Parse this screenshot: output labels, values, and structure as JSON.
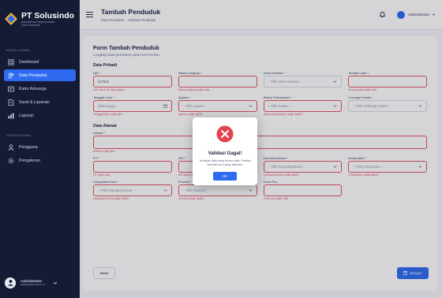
{
  "app": {
    "brand": "PT Solusindo",
    "brand_sub_1": "Administrasi Kependudukan",
    "brand_sub_2": "Data Penduduk"
  },
  "sidebar": {
    "sections": [
      {
        "title": "MENU UTAMA"
      },
      {
        "title": "PENGATURAN"
      }
    ],
    "items": [
      {
        "label": "Dashboard",
        "icon": "grid-icon"
      },
      {
        "label": "Data Penduduk",
        "icon": "users-icon",
        "active": true
      },
      {
        "label": "Kartu Keluarga",
        "icon": "card-icon"
      },
      {
        "label": "Surat & Layanan",
        "icon": "document-icon"
      },
      {
        "label": "Laporan",
        "icon": "chart-icon"
      },
      {
        "label": "Pengguna",
        "icon": "user-icon"
      },
      {
        "label": "Pengaturan",
        "icon": "gear-icon"
      }
    ],
    "user": {
      "name": "Administrator",
      "email": "admin@solusindo.id"
    }
  },
  "header": {
    "title": "Tambah Penduduk",
    "breadcrumb": [
      "Data Penduduk",
      "Tambah Penduduk"
    ],
    "user_label": "Administrator"
  },
  "form": {
    "title": "Form Tambah Penduduk",
    "subtitle": "Lengkapi data penduduk pada form berikut.",
    "section_personal": "Data Pribadi",
    "section_address": "Data Alamat",
    "fields": {
      "nik": {
        "label": "NIK *",
        "value": "327601",
        "error": "NIK harus 16 digit angka."
      },
      "nama": {
        "label": "Nama Lengkap *",
        "value": "",
        "error": "Nama lengkap wajib diisi."
      },
      "jk": {
        "label": "Jenis Kelamin *",
        "value": "-- Pilih Jenis Kelamin --",
        "error": ""
      },
      "tempat_lahir": {
        "label": "Tempat Lahir *",
        "value": "",
        "error": "Tempat lahir wajib diisi."
      },
      "tanggal_lahir": {
        "label": "Tanggal Lahir *",
        "value": "dd/mm/yyyy",
        "error": "Tanggal lahir wajib diisi."
      },
      "agama": {
        "label": "Agama *",
        "value": "-- Pilih Agama --",
        "error": "Agama wajib dipilih."
      },
      "status_perkawinan": {
        "label": "Status Perkawinan *",
        "value": "-- Pilih Status --",
        "error": "Status perkawinan wajib dipilih."
      },
      "golongan_darah": {
        "label": "Golongan Darah",
        "value": "-- Pilih Golongan Darah --",
        "error": ""
      },
      "alamat": {
        "label": "Alamat *",
        "value": "",
        "error": "Alamat wajib diisi."
      },
      "rt": {
        "label": "RT *",
        "value": "",
        "error": "RT wajib diisi."
      },
      "rw": {
        "label": "RW *",
        "value": "",
        "error": "RW wajib diisi."
      },
      "kelurahan": {
        "label": "Kelurahan/Desa *",
        "value": "-- Pilih Kelurahan/Desa --",
        "error": "Kelurahan/Desa wajib dipilih."
      },
      "kecamatan": {
        "label": "Kecamatan *",
        "value": "-- Pilih Kecamatan --",
        "error": "Kecamatan wajib dipilih."
      },
      "kabupaten": {
        "label": "Kabupaten/Kota *",
        "value": "-- Pilih Kabupaten/Kota --",
        "error": "Kabupaten/Kota wajib dipilih."
      },
      "provinsi": {
        "label": "Provinsi *",
        "value": "-- Pilih Provinsi --",
        "error": "Provinsi wajib dipilih."
      },
      "kode_pos": {
        "label": "Kode Pos",
        "value": "",
        "error": "Kode pos wajib diisi."
      }
    },
    "back_label": "Batal",
    "save_label": "Simpan"
  },
  "modal": {
    "title": "Validasi Gagal!",
    "message": "Terdapat data yang belum valid. Periksa kembali form yang ditandai.",
    "ok_label": "OK"
  },
  "colors": {
    "accent": "#2e6bf0",
    "error": "#e05260",
    "sidebar": "#151b35"
  }
}
